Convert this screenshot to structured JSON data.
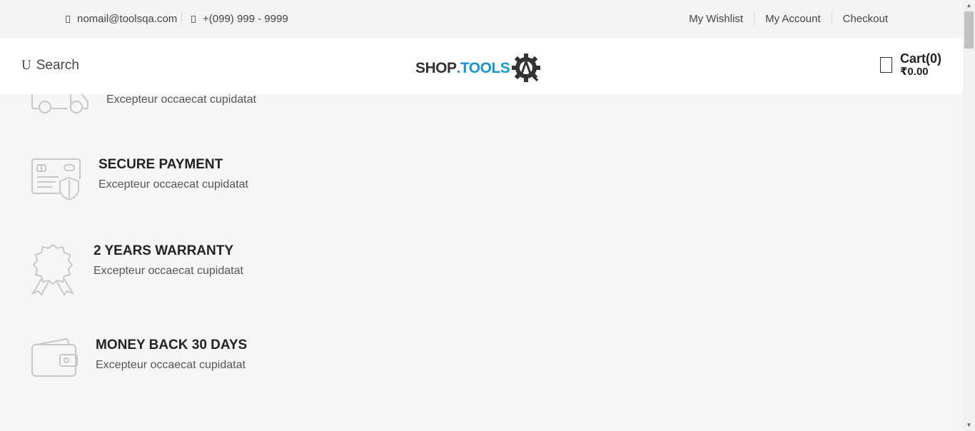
{
  "topbar": {
    "email": "nomail@toolsqa.com",
    "phone": "+(099) 999 - 9999",
    "links": [
      "My Wishlist",
      "My Account",
      "Checkout"
    ]
  },
  "header": {
    "search_label": "Search",
    "search_glyph": "U",
    "logo": {
      "shop": "SHOP",
      "tools": ".TOOLS"
    },
    "cart": {
      "label": "Cart(0)",
      "amount": "₹0.00"
    }
  },
  "features": [
    {
      "title": "",
      "desc": "Excepteur occaecat cupidatat",
      "icon": "truck-icon"
    },
    {
      "title": "SECURE PAYMENT",
      "desc": "Excepteur occaecat cupidatat",
      "icon": "card-shield-icon"
    },
    {
      "title": "2 YEARS WARRANTY",
      "desc": "Excepteur occaecat cupidatat",
      "icon": "ribbon-badge-icon"
    },
    {
      "title": "MONEY BACK 30 DAYS",
      "desc": "Excepteur occaecat cupidatat",
      "icon": "wallet-icon"
    }
  ],
  "colors": {
    "accent": "#1a95d3",
    "icon_gray": "#c8c8c8"
  }
}
